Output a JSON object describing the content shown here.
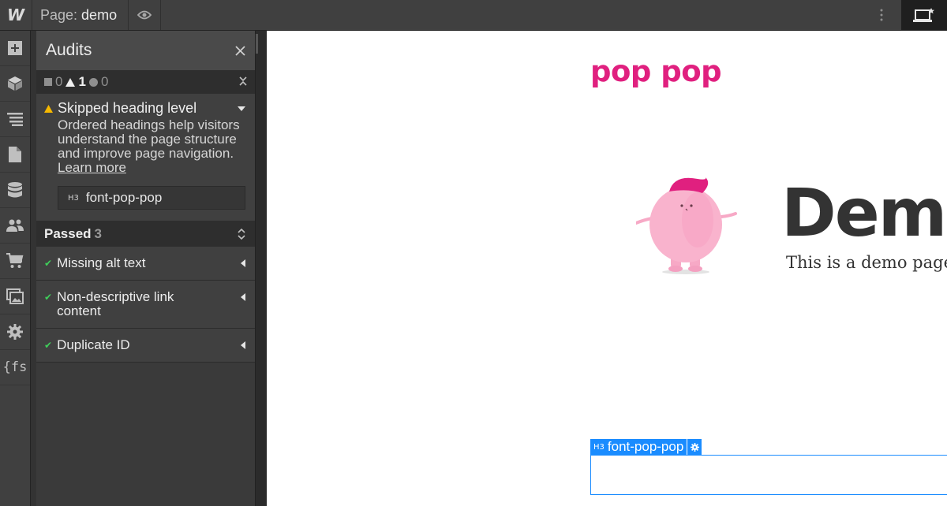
{
  "topbar": {
    "logo_text": "W",
    "page_prefix": "Page:",
    "page_name": "demo",
    "icons": [
      "eye-icon",
      "more-vertical-icon",
      "preview-icon"
    ]
  },
  "leftbar": {
    "items": [
      {
        "icon": "add-icon"
      },
      {
        "icon": "cube-icon"
      },
      {
        "icon": "navigator-icon"
      },
      {
        "icon": "pages-icon"
      },
      {
        "icon": "cms-icon"
      },
      {
        "icon": "users-icon"
      },
      {
        "icon": "ecommerce-cart-icon"
      },
      {
        "icon": "assets-icon"
      },
      {
        "icon": "settings-icon"
      },
      {
        "icon": "variables-icon",
        "label": "{fs"
      }
    ]
  },
  "audits": {
    "title": "Audits",
    "counts": {
      "errors": "0",
      "warnings": "1",
      "suggestions": "0"
    },
    "issue": {
      "title": "Skipped heading level",
      "description": "Ordered headings help visitors understand the page structure and improve page navigation.",
      "learn_more": "Learn more",
      "element_tag": "H3",
      "element_class": "font-pop-pop"
    },
    "passed": {
      "label": "Passed",
      "count": "3",
      "items": [
        {
          "label": "Missing alt text"
        },
        {
          "label": "Non-descriptive link content"
        },
        {
          "label": "Duplicate ID"
        }
      ]
    }
  },
  "canvas": {
    "brand": "pop pop",
    "hero_title": "Demo",
    "hero_subtitle": "This is a demo page",
    "selected_tag": "H3",
    "selected_class": "font-pop-pop",
    "brand_color": "#e0207f",
    "selection_color": "#1a8cff"
  }
}
